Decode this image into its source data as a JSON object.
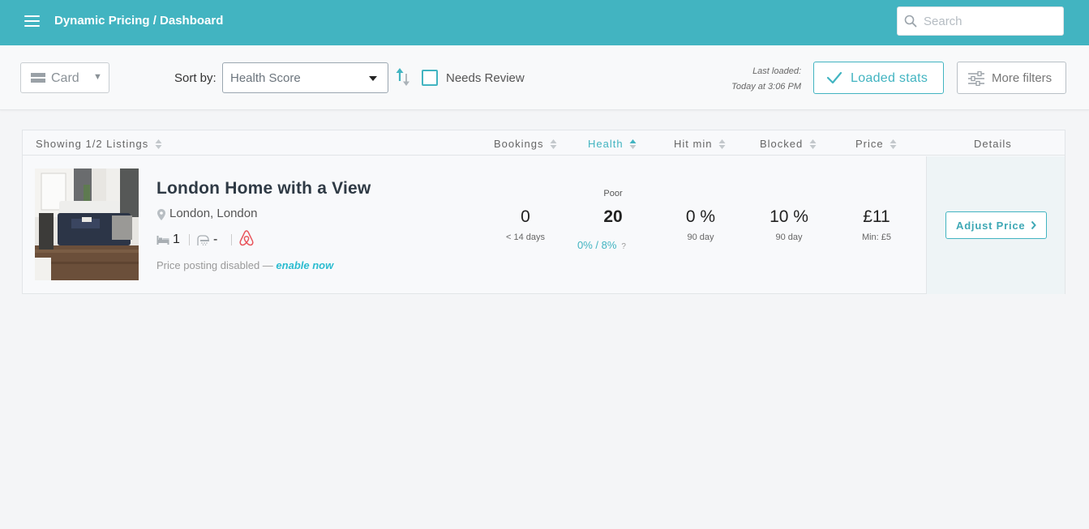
{
  "nav": {
    "title": "Dynamic Pricing / Dashboard",
    "search_placeholder": "Search"
  },
  "toolbar": {
    "view_select": "Card",
    "sort_label": "Sort by:",
    "sort_value": "Health Score",
    "needs_review_label": "Needs Review",
    "needs_review_checked": false,
    "last_loaded_label": "Last loaded:",
    "last_loaded_time": "Today at 3:06 PM",
    "loaded_stats_button": "Loaded stats",
    "more_filters_button": "More filters"
  },
  "table": {
    "columns": {
      "listings": "Showing 1/2 Listings",
      "bookings": "Bookings",
      "health": "Health",
      "hit_min": "Hit min",
      "blocked": "Blocked",
      "price": "Price",
      "details": "Details"
    },
    "active_sort_column": "health",
    "rows": [
      {
        "title": "London Home with a View",
        "location": "London, London",
        "beds": "1",
        "baths": "-",
        "platform_icon": "airbnb-icon",
        "posting_text": "Price posting disabled — ",
        "posting_link": "enable now",
        "bookings_value": "0",
        "bookings_sub": "< 14 days",
        "health_label": "Poor",
        "health_value": "20",
        "health_sub": "0% / 8%",
        "health_help": "?",
        "hit_min_value": "0 %",
        "hit_min_sub": "90 day",
        "blocked_value": "10 %",
        "blocked_sub": "90 day",
        "price_value": "£11",
        "price_sub": "Min: £5",
        "action_button": "Adjust Price"
      }
    ]
  },
  "colors": {
    "brand": "#42b4c1",
    "link": "#2bbcd0",
    "airbnb": "#e8555c"
  }
}
